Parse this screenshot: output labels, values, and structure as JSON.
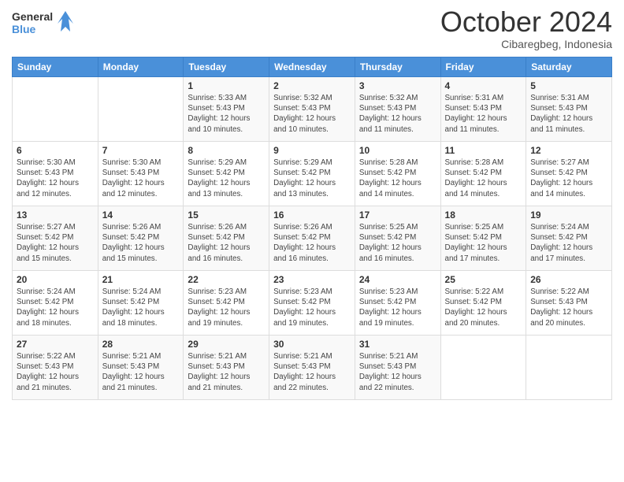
{
  "logo": {
    "line1": "General",
    "line2": "Blue"
  },
  "header": {
    "month": "October 2024",
    "location": "Cibaregbeg, Indonesia"
  },
  "weekdays": [
    "Sunday",
    "Monday",
    "Tuesday",
    "Wednesday",
    "Thursday",
    "Friday",
    "Saturday"
  ],
  "weeks": [
    [
      {
        "day": "",
        "info": ""
      },
      {
        "day": "",
        "info": ""
      },
      {
        "day": "1",
        "info": "Sunrise: 5:33 AM\nSunset: 5:43 PM\nDaylight: 12 hours\nand 10 minutes."
      },
      {
        "day": "2",
        "info": "Sunrise: 5:32 AM\nSunset: 5:43 PM\nDaylight: 12 hours\nand 10 minutes."
      },
      {
        "day": "3",
        "info": "Sunrise: 5:32 AM\nSunset: 5:43 PM\nDaylight: 12 hours\nand 11 minutes."
      },
      {
        "day": "4",
        "info": "Sunrise: 5:31 AM\nSunset: 5:43 PM\nDaylight: 12 hours\nand 11 minutes."
      },
      {
        "day": "5",
        "info": "Sunrise: 5:31 AM\nSunset: 5:43 PM\nDaylight: 12 hours\nand 11 minutes."
      }
    ],
    [
      {
        "day": "6",
        "info": "Sunrise: 5:30 AM\nSunset: 5:43 PM\nDaylight: 12 hours\nand 12 minutes."
      },
      {
        "day": "7",
        "info": "Sunrise: 5:30 AM\nSunset: 5:43 PM\nDaylight: 12 hours\nand 12 minutes."
      },
      {
        "day": "8",
        "info": "Sunrise: 5:29 AM\nSunset: 5:42 PM\nDaylight: 12 hours\nand 13 minutes."
      },
      {
        "day": "9",
        "info": "Sunrise: 5:29 AM\nSunset: 5:42 PM\nDaylight: 12 hours\nand 13 minutes."
      },
      {
        "day": "10",
        "info": "Sunrise: 5:28 AM\nSunset: 5:42 PM\nDaylight: 12 hours\nand 14 minutes."
      },
      {
        "day": "11",
        "info": "Sunrise: 5:28 AM\nSunset: 5:42 PM\nDaylight: 12 hours\nand 14 minutes."
      },
      {
        "day": "12",
        "info": "Sunrise: 5:27 AM\nSunset: 5:42 PM\nDaylight: 12 hours\nand 14 minutes."
      }
    ],
    [
      {
        "day": "13",
        "info": "Sunrise: 5:27 AM\nSunset: 5:42 PM\nDaylight: 12 hours\nand 15 minutes."
      },
      {
        "day": "14",
        "info": "Sunrise: 5:26 AM\nSunset: 5:42 PM\nDaylight: 12 hours\nand 15 minutes."
      },
      {
        "day": "15",
        "info": "Sunrise: 5:26 AM\nSunset: 5:42 PM\nDaylight: 12 hours\nand 16 minutes."
      },
      {
        "day": "16",
        "info": "Sunrise: 5:26 AM\nSunset: 5:42 PM\nDaylight: 12 hours\nand 16 minutes."
      },
      {
        "day": "17",
        "info": "Sunrise: 5:25 AM\nSunset: 5:42 PM\nDaylight: 12 hours\nand 16 minutes."
      },
      {
        "day": "18",
        "info": "Sunrise: 5:25 AM\nSunset: 5:42 PM\nDaylight: 12 hours\nand 17 minutes."
      },
      {
        "day": "19",
        "info": "Sunrise: 5:24 AM\nSunset: 5:42 PM\nDaylight: 12 hours\nand 17 minutes."
      }
    ],
    [
      {
        "day": "20",
        "info": "Sunrise: 5:24 AM\nSunset: 5:42 PM\nDaylight: 12 hours\nand 18 minutes."
      },
      {
        "day": "21",
        "info": "Sunrise: 5:24 AM\nSunset: 5:42 PM\nDaylight: 12 hours\nand 18 minutes."
      },
      {
        "day": "22",
        "info": "Sunrise: 5:23 AM\nSunset: 5:42 PM\nDaylight: 12 hours\nand 19 minutes."
      },
      {
        "day": "23",
        "info": "Sunrise: 5:23 AM\nSunset: 5:42 PM\nDaylight: 12 hours\nand 19 minutes."
      },
      {
        "day": "24",
        "info": "Sunrise: 5:23 AM\nSunset: 5:42 PM\nDaylight: 12 hours\nand 19 minutes."
      },
      {
        "day": "25",
        "info": "Sunrise: 5:22 AM\nSunset: 5:42 PM\nDaylight: 12 hours\nand 20 minutes."
      },
      {
        "day": "26",
        "info": "Sunrise: 5:22 AM\nSunset: 5:43 PM\nDaylight: 12 hours\nand 20 minutes."
      }
    ],
    [
      {
        "day": "27",
        "info": "Sunrise: 5:22 AM\nSunset: 5:43 PM\nDaylight: 12 hours\nand 21 minutes."
      },
      {
        "day": "28",
        "info": "Sunrise: 5:21 AM\nSunset: 5:43 PM\nDaylight: 12 hours\nand 21 minutes."
      },
      {
        "day": "29",
        "info": "Sunrise: 5:21 AM\nSunset: 5:43 PM\nDaylight: 12 hours\nand 21 minutes."
      },
      {
        "day": "30",
        "info": "Sunrise: 5:21 AM\nSunset: 5:43 PM\nDaylight: 12 hours\nand 22 minutes."
      },
      {
        "day": "31",
        "info": "Sunrise: 5:21 AM\nSunset: 5:43 PM\nDaylight: 12 hours\nand 22 minutes."
      },
      {
        "day": "",
        "info": ""
      },
      {
        "day": "",
        "info": ""
      }
    ]
  ]
}
